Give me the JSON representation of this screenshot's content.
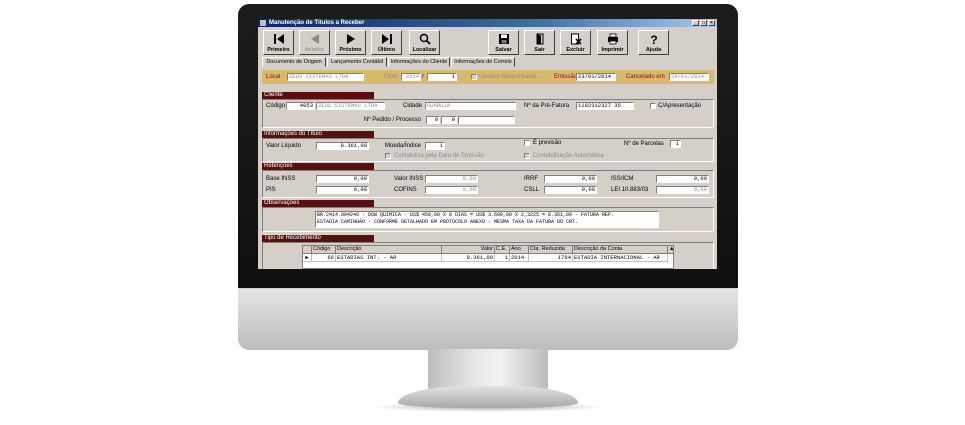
{
  "window": {
    "title": "Manutenção de Títulos a Receber"
  },
  "toolbar": [
    {
      "label": "Primeiro",
      "icon": "first-icon",
      "enabled": true
    },
    {
      "label": "Anterior",
      "icon": "previous-icon",
      "enabled": false
    },
    {
      "label": "Próximo",
      "icon": "next-icon",
      "enabled": true
    },
    {
      "label": "Último",
      "icon": "last-icon",
      "enabled": true
    },
    {
      "label": "Localizar",
      "icon": "search-icon",
      "enabled": true
    },
    {
      "label": "Salvar",
      "icon": "save-icon",
      "enabled": true
    },
    {
      "label": "Sair",
      "icon": "exit-icon",
      "enabled": true
    },
    {
      "label": "Excluir",
      "icon": "delete-icon",
      "enabled": true
    },
    {
      "label": "Imprimir",
      "icon": "print-icon",
      "enabled": true
    },
    {
      "label": "Ajuda",
      "icon": "help-icon",
      "enabled": true
    }
  ],
  "tabs": [
    "Documento de Origem",
    "Lançamento Contábil",
    "Informações do Cliente",
    "Informações do Correio"
  ],
  "header": {
    "local_label": "Local",
    "local_value": "ZEUS SISTEMAS LTDA",
    "titulo_label": "Título",
    "titulo_year": "2014",
    "titulo_number": "1",
    "usuario_label": "Usuário Responsável...",
    "emissao_label": "Emissão",
    "emissao_value": "23/01/2014",
    "cancelado_label": "Cancelado em",
    "cancelado_value": "29/01/2014"
  },
  "cliente": {
    "section": "Cliente",
    "codigo_label": "Código",
    "codigo_value": "4053",
    "nome_value": "ZEUS SISTEMAS LTDA",
    "cidade_label": "Cidade",
    "cidade_value": "GUARUJA",
    "pre_fatura_label": "Nº da Pré-Fatura",
    "pre_fatura_value": "1182312327 35",
    "apresentacao_label": "C/Apresentação",
    "pedido_label": "Nº Pedido / Processo",
    "pedido_value": "0",
    "processo_value": "0"
  },
  "titulo": {
    "section": "Informações do Título",
    "valor_liquido_label": "Valor Líquido",
    "valor_liquido_value": "8.361,00",
    "moeda_label": "Moeda/Índice",
    "moeda_value": "1",
    "previsao_label": "É previsão",
    "parcelas_label": "Nº de Parcelas",
    "parcelas_value": "1",
    "contab_emissao_label": "Contabiliza pela Data de Emissão",
    "contab_auto_label": "Contabilização Automática"
  },
  "retencoes": {
    "section": "Retenções",
    "base_inss_label": "Base INSS",
    "base_inss_value": "0,00",
    "valor_inss_label": "Valor INSS",
    "valor_inss_value": "0,00",
    "irrf_label": "IRRF",
    "irrf_value": "0,00",
    "iss_label": "ISS/ICM",
    "iss_value": "0,00",
    "pis_label": "PIS",
    "pis_value": "0,00",
    "cofins_label": "COFINS",
    "cofins_value": "0,00",
    "csll_label": "CSLL",
    "csll_value": "0,00",
    "lei_label": "LEI 10.883/03",
    "lei_value": "0,00"
  },
  "observacoes": {
    "section": "Observações",
    "line1": "BR.2414.004240 - DOW QUIMICA - US$ 450,00 X 8 DIAS = US$ 3.600,00 X 2,3225 = 8.361,00 - FATURA REF.",
    "line2": "ESTADIA CAMINHÃO - CONFORME DETALHADO EM PROTOCOLO ANEXO - MESMA TAXA DA FATURA DO CRT."
  },
  "recebimento": {
    "section": "Tipo de Recebimento",
    "columns": [
      "Código",
      "Descrição",
      "Valor",
      "C.E.",
      "Ano",
      "Cta. Reduzida",
      "Descrição da Conta"
    ],
    "rows": [
      [
        "66",
        "ESTADIAS INT. - AR",
        "8.361,00",
        "1",
        "2014",
        "1794",
        "ESTADIA INTERNACIONAL - AR"
      ]
    ]
  },
  "colors": {
    "section_header": "#5a0e0e",
    "gold_bar": "#d9b96a",
    "titlebar": "#0a246a"
  }
}
